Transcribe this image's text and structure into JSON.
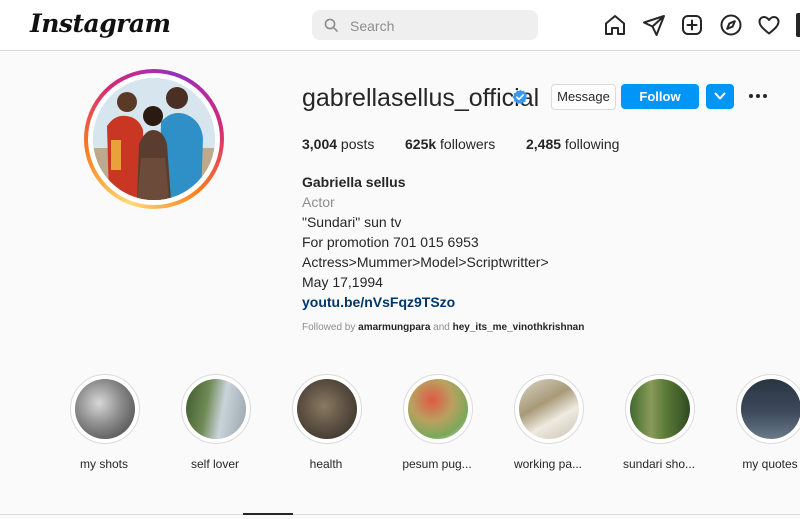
{
  "app": {
    "logo": "Instagram"
  },
  "search": {
    "placeholder": "Search"
  },
  "nav": {
    "icons": [
      "home-icon",
      "direct-icon",
      "new-post-icon",
      "explore-icon",
      "activity-icon"
    ]
  },
  "profile": {
    "username": "gabrellasellus_official",
    "verified": true,
    "message_label": "Message",
    "follow_label": "Follow",
    "stats": {
      "posts_count": "3,004",
      "posts_label": " posts",
      "followers_count": "625k",
      "followers_label": " followers",
      "following_count": "2,485",
      "following_label": " following"
    },
    "bio": {
      "name": "Gabriella sellus",
      "category": "Actor",
      "lines": [
        "\"Sundari\" sun tv",
        "For promotion 701 015 6953",
        "Actress>Mummer>Model>Scriptwritter>",
        "May 17,1994"
      ],
      "link": "youtu.be/nVsFqz9TSzo"
    },
    "followed_by": {
      "prefix": "Followed by ",
      "user1": "amarmungpara",
      "sep": " and ",
      "user2": "hey_its_me_vinothkrishnan"
    }
  },
  "highlights": [
    {
      "label": "my shots"
    },
    {
      "label": "self lover"
    },
    {
      "label": "health"
    },
    {
      "label": "pesum pug..."
    },
    {
      "label": "working pa..."
    },
    {
      "label": "sundari sho..."
    },
    {
      "label": "my quotes"
    }
  ],
  "colors": {
    "accent": "#0095f6",
    "link": "#00376b",
    "muted": "#8e8e8e"
  }
}
